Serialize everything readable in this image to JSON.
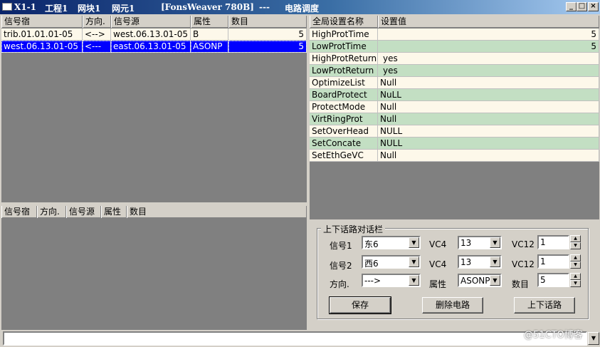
{
  "titlebar": {
    "items": [
      "X1-1",
      "工程1",
      "网块1",
      "网元1",
      "[FonsWeaver 780B]",
      "---",
      "电路调度"
    ],
    "min": "_",
    "max": "□",
    "close": "×"
  },
  "circuit_table": {
    "headers": [
      "信号宿",
      "方向.",
      "信号源",
      "属性",
      "数目"
    ],
    "rows": [
      [
        "trib.01.01.01-05",
        "<-->",
        "west.06.13.01-05",
        "B",
        "5"
      ],
      [
        "west.06.13.01-05",
        "<---",
        "east.06.13.01-05",
        "ASONP",
        "5"
      ]
    ]
  },
  "lower_table": {
    "headers": [
      "信号宿",
      "方向.",
      "信号源",
      "属性",
      "数目"
    ]
  },
  "settings_table": {
    "headers": [
      "全局设置名称",
      "设置值"
    ],
    "rows": [
      [
        "HighProtTime",
        "5"
      ],
      [
        "LowProtTime",
        "5"
      ],
      [
        "HighProtReturn",
        "yes"
      ],
      [
        "LowProtReturn",
        "yes"
      ],
      [
        "OptimizeList",
        "Null"
      ],
      [
        "BoardProtect",
        "NuLL"
      ],
      [
        "ProtectMode",
        "Null"
      ],
      [
        "VirtRingProt",
        "Null"
      ],
      [
        "SetOverHead",
        "NULL"
      ],
      [
        "SetConcate",
        "NULL"
      ],
      [
        "SetEthGeVC",
        "Null"
      ]
    ]
  },
  "dialog": {
    "title": "上下话路对话栏",
    "signal1_label": "信号1",
    "signal1_value": "东6",
    "signal2_label": "信号2",
    "signal2_value": "西6",
    "direction_label": "方向.",
    "direction_value": "--->",
    "vc4_label_1": "VC4",
    "vc4_value_1": "13",
    "vc4_label_2": "VC4",
    "vc4_value_2": "13",
    "attr_label": "属性",
    "attr_value": "ASONP",
    "vc12_label_1": "VC12",
    "vc12_value_1": "1",
    "vc12_label_2": "VC12",
    "vc12_value_2": "1",
    "count_label": "数目",
    "count_value": "5",
    "save_button": "保存",
    "delete_button": "删除电路",
    "add_drop_button": "上下话路"
  },
  "watermark": "@51CTO博客",
  "icons": {
    "dropdown": "▼",
    "spin_up": "▲",
    "spin_down": "▼"
  }
}
